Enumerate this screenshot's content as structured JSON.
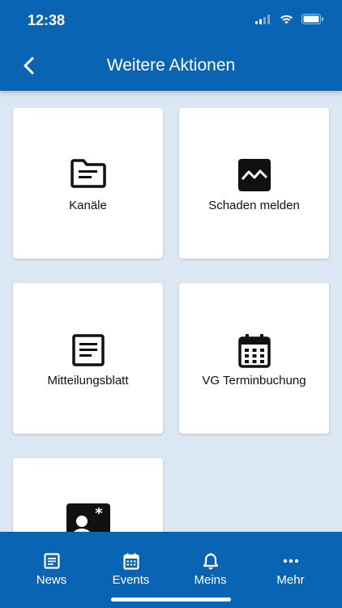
{
  "status_bar": {
    "time": "12:38"
  },
  "header": {
    "title": "Weitere Aktionen"
  },
  "tiles": [
    {
      "label": "Kanäle",
      "icon": "folder-icon"
    },
    {
      "label": "Schaden melden",
      "icon": "broken-image-icon"
    },
    {
      "label": "Mitteilungsblatt",
      "icon": "document-icon"
    },
    {
      "label": "VG Terminbuchung",
      "icon": "calendar-icon"
    },
    {
      "label": "",
      "icon": "contact-card-icon"
    }
  ],
  "tabbar": {
    "items": [
      {
        "label": "News",
        "icon": "news-icon"
      },
      {
        "label": "Events",
        "icon": "calendar-icon"
      },
      {
        "label": "Meins",
        "icon": "bell-icon"
      },
      {
        "label": "Mehr",
        "icon": "more-icon"
      }
    ]
  },
  "colors": {
    "primary": "#0a64b4",
    "background": "#dbe8f3",
    "tile": "#ffffff"
  }
}
